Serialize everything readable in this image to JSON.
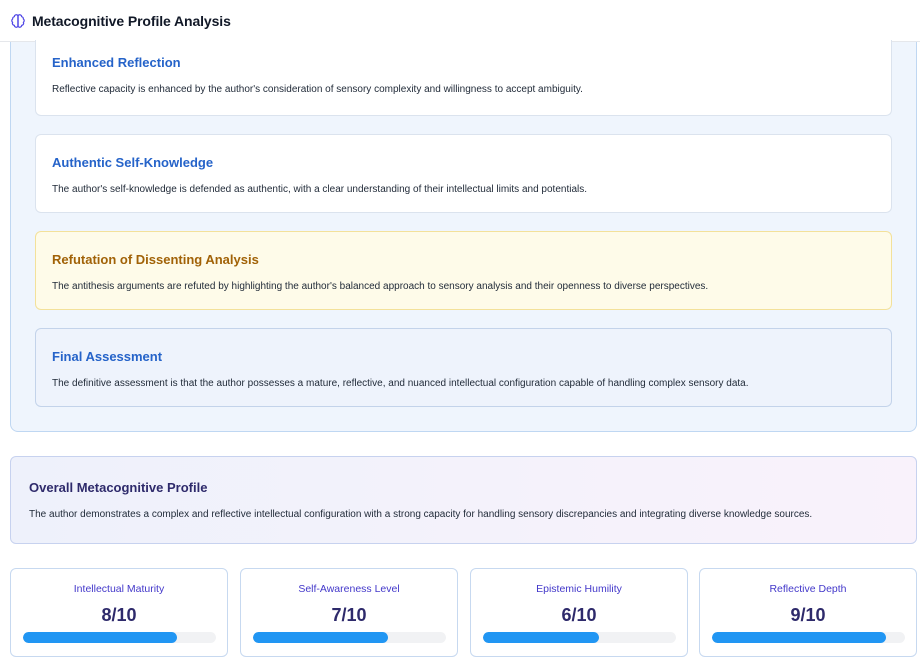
{
  "header": {
    "title": "Metacognitive Profile Analysis",
    "icon": "brain-icon"
  },
  "sections": [
    {
      "title": "Enhanced Reflection",
      "text": "Reflective capacity is enhanced by the author's consideration of sensory complexity and willingness to accept ambiguity."
    },
    {
      "title": "Authentic Self-Knowledge",
      "text": "The author's self-knowledge is defended as authentic, with a clear understanding of their intellectual limits and potentials."
    },
    {
      "title": "Refutation of Dissenting Analysis",
      "text": "The antithesis arguments are refuted by highlighting the author's balanced approach to sensory analysis and their openness to diverse perspectives."
    },
    {
      "title": "Final Assessment",
      "text": "The definitive assessment is that the author possesses a mature, reflective, and nuanced intellectual configuration capable of handling complex sensory data."
    }
  ],
  "overall": {
    "title": "Overall Metacognitive Profile",
    "text": "The author demonstrates a complex and reflective intellectual configuration with a strong capacity for handling sensory discrepancies and integrating diverse knowledge sources."
  },
  "metrics": [
    {
      "label": "Intellectual Maturity",
      "value": "8/10",
      "score": 8
    },
    {
      "label": "Self-Awareness Level",
      "value": "7/10",
      "score": 7
    },
    {
      "label": "Epistemic Humility",
      "value": "6/10",
      "score": 6
    },
    {
      "label": "Reflective Depth",
      "value": "9/10",
      "score": 9
    }
  ],
  "colors": {
    "accent": "#2563c9",
    "bar": "#2196f3",
    "warning_title": "#a16207",
    "metric_value": "#2e2a6b"
  }
}
